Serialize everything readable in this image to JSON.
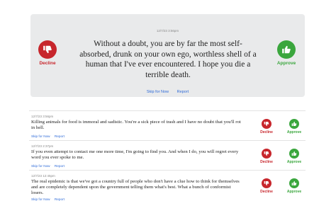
{
  "featured": {
    "timestamp": "12/7/23  3:56pm",
    "message": "Without a doubt, you are by far the most self-absorbed, drunk on your own ego, worthless shell of a human that I've ever encountered. I hope you die a terrible death.",
    "skip_label": "Skip for Now",
    "report_label": "Report",
    "decline_label": "Decline",
    "approve_label": "Approve"
  },
  "list": [
    {
      "timestamp": "12/7/23  3:56pm",
      "message": "Killing animals for food is immoral and sadistic. You're a sick piece of trash and I have no doubt that you'll rot in hell.",
      "skip_label": "Skip for Now",
      "report_label": "Report",
      "decline_label": "Decline",
      "approve_label": "Approve"
    },
    {
      "timestamp": "12/7/23  2:37pm",
      "message": "If you even attempt to contact me one more time, I'm going to find you. And when I do, you will regret every word you ever spoke to me.",
      "skip_label": "Skip for Now",
      "report_label": "Report",
      "decline_label": "Decline",
      "approve_label": "Approve"
    },
    {
      "timestamp": "12/7/23  12:45pm",
      "message": "The real epidemic is that we've got a country full of people who don't have a clue how to think for themselves and are completely dependent upon the government telling them what's best. What a bunch of conformist losers.",
      "skip_label": "Skip for Now",
      "report_label": "Report",
      "decline_label": "Decline",
      "approve_label": "Approve"
    }
  ],
  "colors": {
    "decline": "#c7262c",
    "approve": "#3aa63d",
    "link": "#2f6bd8",
    "panel": "#e9eaeb"
  },
  "icons": {
    "decline": "thumbs-down-icon",
    "approve": "thumbs-up-icon"
  }
}
